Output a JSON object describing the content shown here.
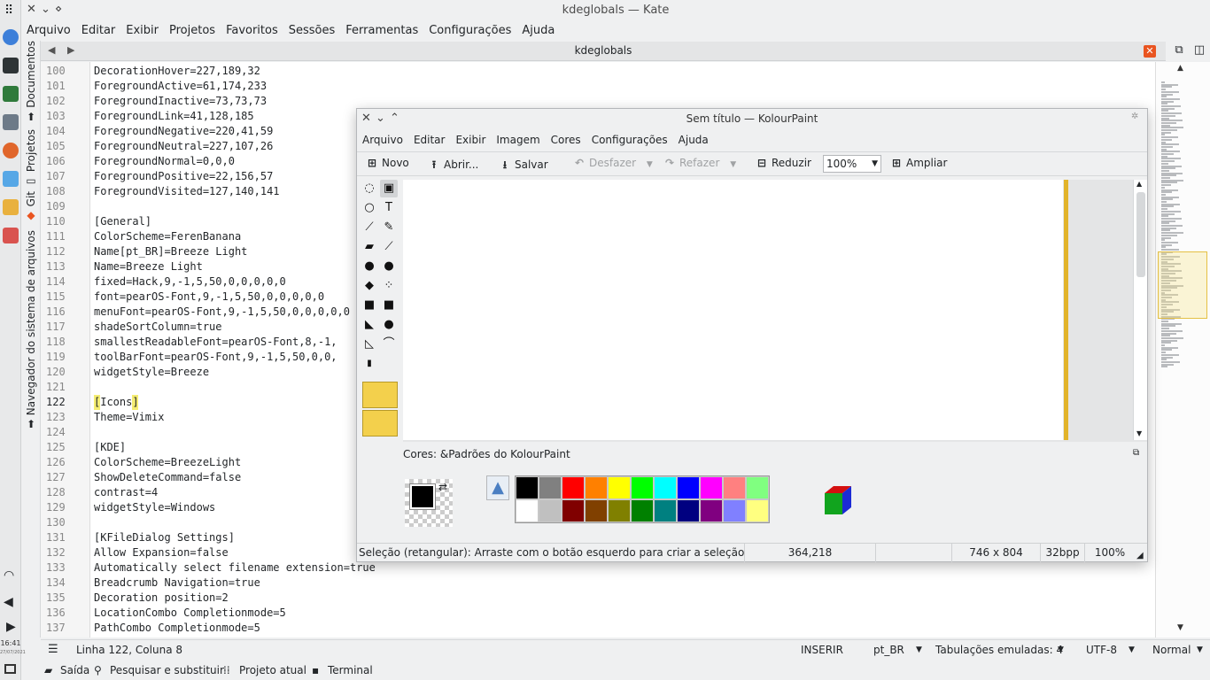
{
  "kate": {
    "title": "kdeglobals — Kate",
    "menu": [
      "Arquivo",
      "Editar",
      "Exibir",
      "Projetos",
      "Favoritos",
      "Sessões",
      "Ferramentas",
      "Configurações",
      "Ajuda"
    ],
    "doc_title": "kdeglobals",
    "side_tabs": [
      "Documentos",
      "Projetos",
      "Git",
      "Navegador do sistema de arquivos"
    ],
    "lines": [
      {
        "n": "100",
        "t": "DecorationHover=227,189,32"
      },
      {
        "n": "101",
        "t": "ForegroundActive=61,174,233"
      },
      {
        "n": "102",
        "t": "ForegroundInactive=73,73,73"
      },
      {
        "n": "103",
        "t": "ForegroundLink=41,128,185"
      },
      {
        "n": "104",
        "t": "ForegroundNegative=220,41,59"
      },
      {
        "n": "105",
        "t": "ForegroundNeutral=227,107,26"
      },
      {
        "n": "106",
        "t": "ForegroundNormal=0,0,0"
      },
      {
        "n": "107",
        "t": "ForegroundPositive=22,156,57"
      },
      {
        "n": "108",
        "t": "ForegroundVisited=127,140,141"
      },
      {
        "n": "109",
        "t": ""
      },
      {
        "n": "110",
        "t": "[General]"
      },
      {
        "n": "111",
        "t": "ColorScheme=FerenBanana"
      },
      {
        "n": "112",
        "t": "Name[pt_BR]=Breeze Light"
      },
      {
        "n": "113",
        "t": "Name=Breeze Light"
      },
      {
        "n": "114",
        "t": "fixed=Hack,9,-1,5,50,0,0,0,0,0"
      },
      {
        "n": "115",
        "t": "font=pearOS-Font,9,-1,5,50,0,0,0,0,0"
      },
      {
        "n": "116",
        "t": "menuFont=pearOS-Font,9,-1,5,50,0,0,0,0,0"
      },
      {
        "n": "117",
        "t": "shadeSortColumn=true"
      },
      {
        "n": "118",
        "t": "smallestReadableFont=pearOS-Font,8,-1,"
      },
      {
        "n": "119",
        "t": "toolBarFont=pearOS-Font,9,-1,5,50,0,0,"
      },
      {
        "n": "120",
        "t": "widgetStyle=Breeze"
      },
      {
        "n": "121",
        "t": ""
      },
      {
        "n": "122",
        "t": "[Icons]"
      },
      {
        "n": "123",
        "t": "Theme=Vimix"
      },
      {
        "n": "124",
        "t": ""
      },
      {
        "n": "125",
        "t": "[KDE]"
      },
      {
        "n": "126",
        "t": "ColorScheme=BreezeLight"
      },
      {
        "n": "127",
        "t": "ShowDeleteCommand=false"
      },
      {
        "n": "128",
        "t": "contrast=4"
      },
      {
        "n": "129",
        "t": "widgetStyle=Windows"
      },
      {
        "n": "130",
        "t": ""
      },
      {
        "n": "131",
        "t": "[KFileDialog Settings]"
      },
      {
        "n": "132",
        "t": "Allow Expansion=false"
      },
      {
        "n": "133",
        "t": "Automatically select filename extension=true"
      },
      {
        "n": "134",
        "t": "Breadcrumb Navigation=true"
      },
      {
        "n": "135",
        "t": "Decoration position=2"
      },
      {
        "n": "136",
        "t": "LocationCombo Completionmode=5"
      },
      {
        "n": "137",
        "t": "PathCombo Completionmode=5"
      }
    ],
    "current_line": "122",
    "status": {
      "position": "Linha 122, Coluna 8",
      "mode": "INSERIR",
      "language": "pt_BR",
      "tabs": "Tabulações emuladas: 4",
      "encoding": "UTF-8",
      "syntax": "Normal"
    },
    "bottom": {
      "output": "Saída",
      "search": "Pesquisar e substituir",
      "project": "Projeto atual",
      "terminal": "Terminal"
    }
  },
  "clock": {
    "time": "16:41",
    "date": "27/07/2021"
  },
  "kolourpaint": {
    "title": "Sem título — KolourPaint",
    "menu": [
      "Arquivo",
      "Editar",
      "Exibir",
      "Imagem",
      "Cores",
      "Configurações",
      "Ajuda"
    ],
    "toolbar": {
      "new": "Novo",
      "open": "Abrir...",
      "save": "Salvar",
      "undo": "Desfazer",
      "redo": "Refazer",
      "zoom_out": "Reduzir",
      "zoom_value": "100%",
      "zoom_in": "Ampliar"
    },
    "colors_title": "Cores: &Padrões do KolourPaint",
    "palette_top": [
      "#000000",
      "#808080",
      "#ff0000",
      "#ff8000",
      "#ffff00",
      "#00ff00",
      "#00ffff",
      "#0000ff",
      "#ff00ff",
      "#ff8080",
      "#80ff80"
    ],
    "palette_bottom": [
      "#ffffff",
      "#c0c0c0",
      "#800000",
      "#804000",
      "#808000",
      "#008000",
      "#008080",
      "#000080",
      "#800080",
      "#8080ff",
      "#ffff80"
    ],
    "status": {
      "message": "Seleção (retangular): Arraste com o botão esquerdo para criar a seleção.",
      "coords": "364,218",
      "size": "746 x 804",
      "depth": "32bpp",
      "zoom": "100%"
    }
  },
  "colors": {
    "accent_yellow": "#f2e84f",
    "canvas_edge": "#e2b42a",
    "close_red": "#e95420"
  }
}
